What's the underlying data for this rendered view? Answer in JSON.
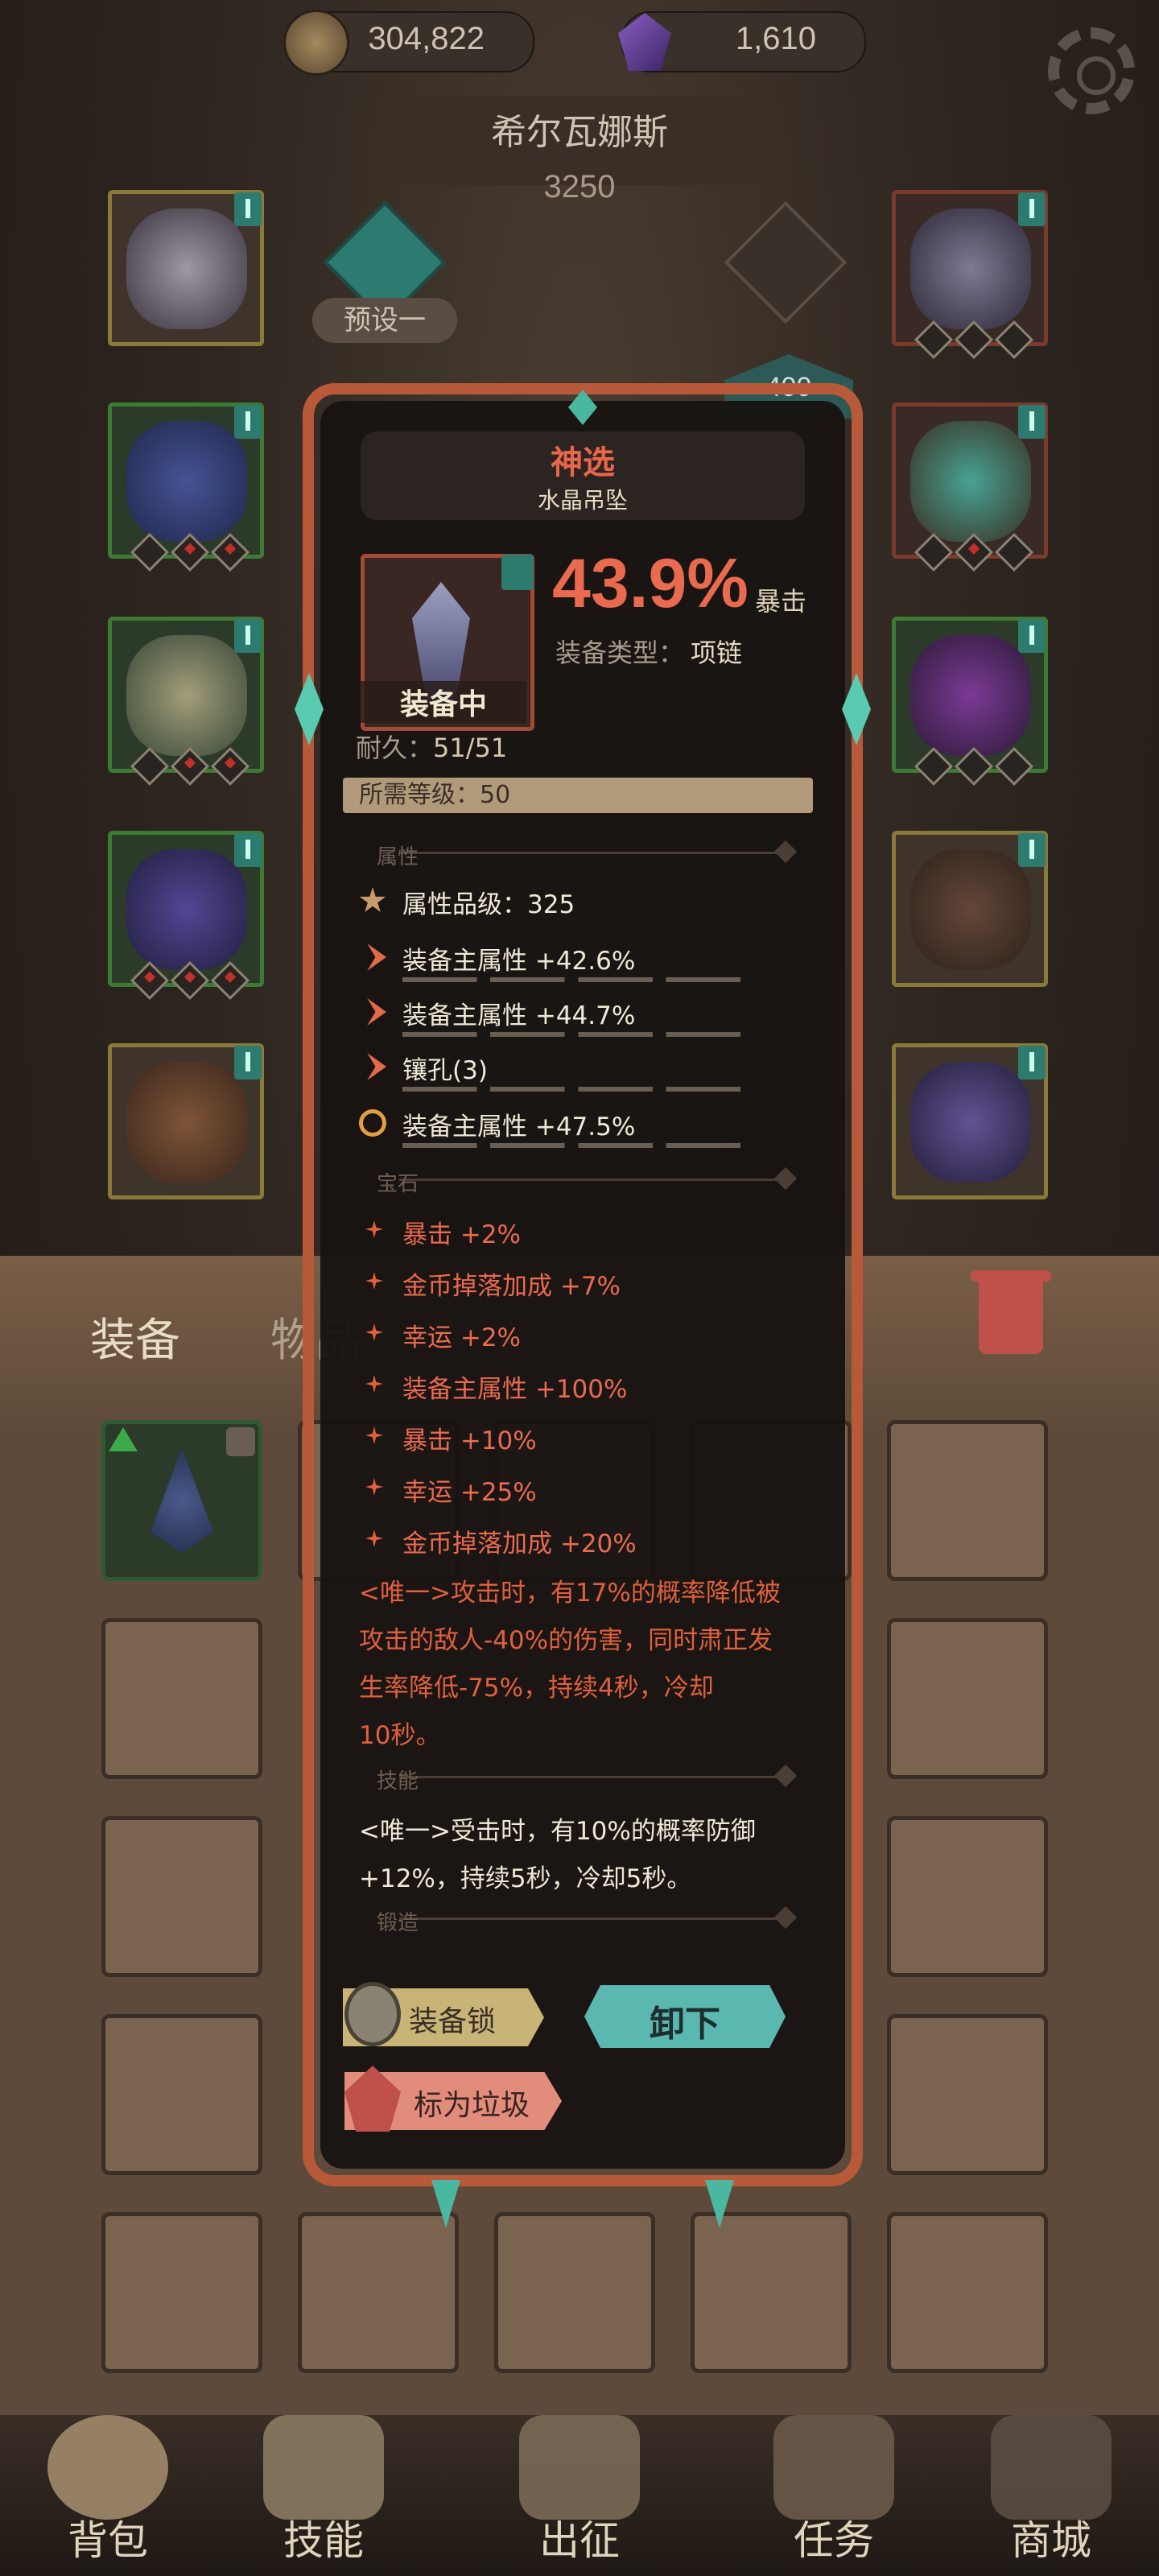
{
  "currency": {
    "gold": "304,822",
    "gems": "1,610"
  },
  "character": {
    "name": "希尔瓦娜斯",
    "power": "3250",
    "preset": "预设一",
    "rank_value": "400"
  },
  "inventory": {
    "tab_equip": "装备",
    "tab_items": "物品"
  },
  "nav": {
    "bag": "背包",
    "skills": "技能",
    "battle": "出征",
    "quests": "任务",
    "shop": "商城"
  },
  "popup": {
    "rarity_title": "神选",
    "item_name": "水晶吊坠",
    "equipped": "装备中",
    "main_value": "43.9%",
    "main_stat": "暴击",
    "type_label": "装备类型：",
    "type_value": "项链",
    "durability_label": "耐久：",
    "durability_value": "51/51",
    "required_level": "所需等级：50",
    "section_attr": "属性",
    "section_gem": "宝石",
    "section_skill": "技能",
    "section_forge": "锻造",
    "attr_grade": "属性品级：325",
    "attributes": [
      "装备主属性 +42.6%",
      "装备主属性 +44.7%",
      "镶孔(3)",
      "装备主属性 +47.5%"
    ],
    "gems": [
      "暴击 +2%",
      "金币掉落加成 +7%",
      "幸运 +2%",
      "装备主属性 +100%",
      "暴击 +10%",
      "幸运 +25%",
      "金币掉落加成 +20%"
    ],
    "unique_gem_lines": [
      "<唯一>攻击时，有17%的概率降低被",
      "攻击的敌人-40%的伤害，同时肃正发",
      "生率降低-75%，持续4秒，冷却",
      "10秒。"
    ],
    "skill_lines": [
      "<唯一>受击时，有10%的概率防御",
      "+12%，持续5秒，冷却5秒。"
    ],
    "btn_lock": "装备锁",
    "btn_unequip": "卸下",
    "btn_junk": "标为垃圾"
  }
}
